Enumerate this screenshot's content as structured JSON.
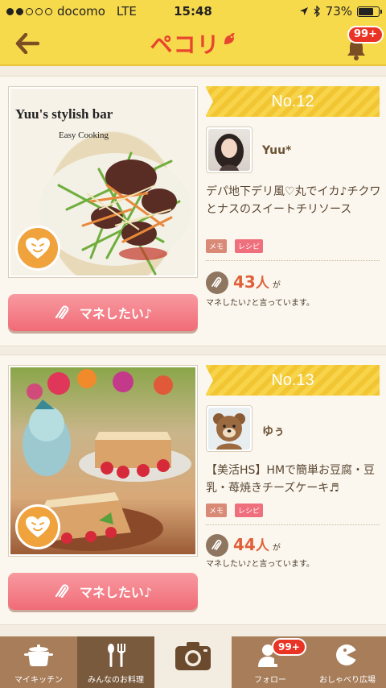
{
  "status": {
    "carrier": "docomo",
    "network": "LTE",
    "time": "15:48",
    "battery": "73%",
    "battery_level": 0.73,
    "signal_bars_filled": 2,
    "signal_bars_total": 5
  },
  "header": {
    "app_title": "ペコリ",
    "notification_count": "99+"
  },
  "cards": [
    {
      "rank": "No.12",
      "image_caption_line1": "Yuu's stylish bar",
      "image_caption_line2": "Easy Cooking",
      "username": "Yuu*",
      "title": "デパ地下デリ風♡丸でイカ♪チクワとナスのスイートチリソース",
      "tags": [
        "メモ",
        "レシピ"
      ],
      "count": "43",
      "count_unit": "人",
      "count_suffix": "が",
      "count_text": "マネしたい♪と言っています。",
      "button_label": "マネしたい♪"
    },
    {
      "rank": "No.13",
      "username": "ゆぅ",
      "title": "【美活HS】HMで簡単お豆腐・豆乳・苺焼きチーズケーキ♬",
      "tags": [
        "メモ",
        "レシピ"
      ],
      "count": "44",
      "count_unit": "人",
      "count_suffix": "が",
      "count_text": "マネしたい♪と言っています。",
      "button_label": "マネしたい♪"
    }
  ],
  "tabs": [
    {
      "label": "マイキッチン",
      "icon": "pot-icon"
    },
    {
      "label": "みんなのお料理",
      "icon": "utensils-icon"
    },
    {
      "label": "",
      "icon": "camera-icon"
    },
    {
      "label": "フォロー",
      "icon": "follow-icon",
      "badge": "99+"
    },
    {
      "label": "おしゃべり広場",
      "icon": "chat-icon"
    }
  ],
  "colors": {
    "header_bg": "#f7d94c",
    "accent_red": "#e8452f",
    "button_pink": "#f06b77",
    "tabbar_brown": "#a77d5a"
  }
}
